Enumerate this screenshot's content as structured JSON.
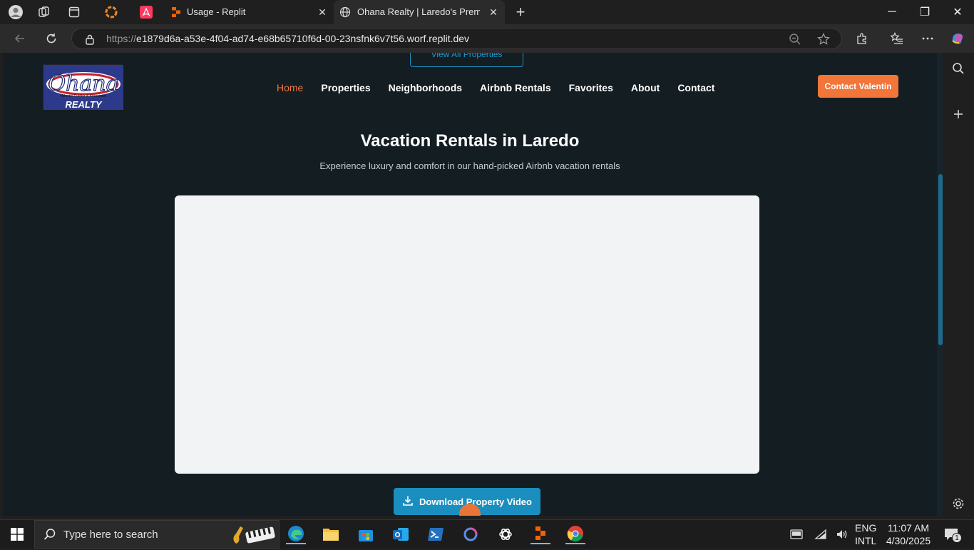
{
  "browser": {
    "tabs": [
      {
        "title": "Usage - Replit",
        "close": "✕"
      },
      {
        "title": "Ohana Realty | Laredo's Premier R",
        "close": "✕"
      }
    ],
    "new_tab": "+",
    "url_prefix": "https://",
    "url_host": "e1879d6a-a53e-4f04-ad74-e68b65710f6d-00-23nsfnk6v7t56.worf.replit.dev",
    "window_controls": {
      "minimize": "─",
      "restore": "❐",
      "close": "✕"
    }
  },
  "site": {
    "view_all_label": "View All Properties",
    "logo": {
      "brand": "Ohana",
      "tagline": "Valentin Cuellar & Associates",
      "sub": "REALTY"
    },
    "nav": [
      {
        "label": "Home",
        "color": "#f2753a"
      },
      {
        "label": "Properties",
        "color": "#ffffff"
      },
      {
        "label": "Neighborhoods",
        "color": "#ffffff"
      },
      {
        "label": "Airbnb Rentals",
        "color": "#ffffff"
      },
      {
        "label": "Favorites",
        "color": "#ffffff"
      },
      {
        "label": "About",
        "color": "#ffffff"
      },
      {
        "label": "Contact",
        "color": "#ffffff"
      }
    ],
    "contact_button": "Contact Valentin",
    "hero_title": "Vacation Rentals in Laredo",
    "hero_subtitle": "Experience luxury and comfort in our hand-picked Airbnb vacation rentals",
    "download_button": "Download Property Video"
  },
  "taskbar": {
    "search_placeholder": "Type here to search",
    "lang_top": "ENG",
    "lang_bottom": "INTL",
    "time": "11:07 AM",
    "date": "4/30/2025",
    "notification_count": "1"
  },
  "colors": {
    "accent": "#f2753a",
    "primary": "#1a8fbf",
    "page_bg": "#141d22"
  }
}
